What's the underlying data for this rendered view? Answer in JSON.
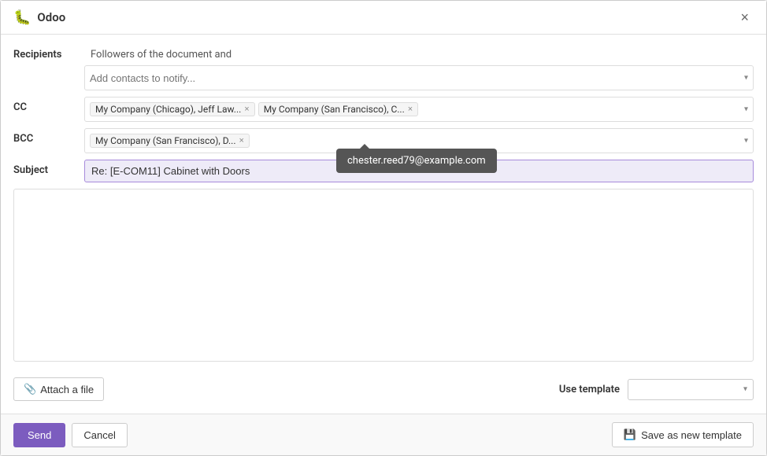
{
  "dialog": {
    "title": "Odoo",
    "close_label": "×"
  },
  "form": {
    "recipients_label": "Recipients",
    "recipients_value": "Followers of the document and",
    "cc_label": "CC",
    "bcc_label": "BCC",
    "subject_label": "Subject",
    "subject_value": "Re: [E-COM11] Cabinet with Doors",
    "add_contacts_placeholder": "Add contacts to notify...",
    "cc_tags": [
      {
        "label": "My Company (Chicago), Jeff Law... ×",
        "name": "My Company (Chicago), Jeff Law..."
      },
      {
        "label": "My Company (San Francisco), C... ×",
        "name": "My Company (San Francisco), C..."
      }
    ],
    "bcc_tags": [
      {
        "label": "My Company (San Francisco), D... ×",
        "name": "My Company (San Francisco), D..."
      }
    ],
    "tooltip_email": "chester.reed79@example.com"
  },
  "actions": {
    "attach_file_label": "Attach a file",
    "use_template_label": "Use template",
    "template_placeholder": ""
  },
  "footer": {
    "send_label": "Send",
    "cancel_label": "Cancel",
    "save_template_label": "Save as new template"
  },
  "icons": {
    "bug": "🐛",
    "paperclip": "📎",
    "save": "💾",
    "chevron_down": "▾"
  }
}
